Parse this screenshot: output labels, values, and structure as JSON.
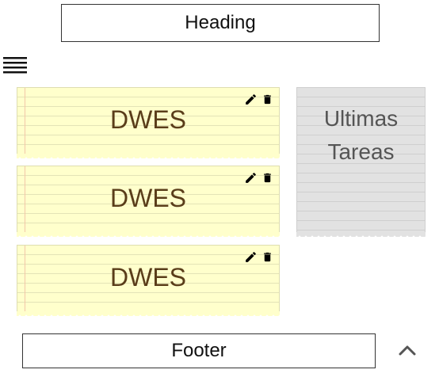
{
  "header": {
    "title": "Heading"
  },
  "menu": {
    "icon": "hamburger-menu-icon"
  },
  "notes": [
    {
      "title": "DWES",
      "color": "#ffffcc",
      "edit_icon": "pencil-icon",
      "delete_icon": "trash-icon"
    },
    {
      "title": "DWES",
      "color": "#ffffcc",
      "edit_icon": "pencil-icon",
      "delete_icon": "trash-icon"
    },
    {
      "title": "DWES",
      "color": "#ffffcc",
      "edit_icon": "pencil-icon",
      "delete_icon": "trash-icon"
    }
  ],
  "recent": {
    "title": "Ultimas Tareas",
    "color": "#e2e2e2"
  },
  "footer": {
    "text": "Footer",
    "scroll_top_icon": "chevron-up-icon"
  }
}
